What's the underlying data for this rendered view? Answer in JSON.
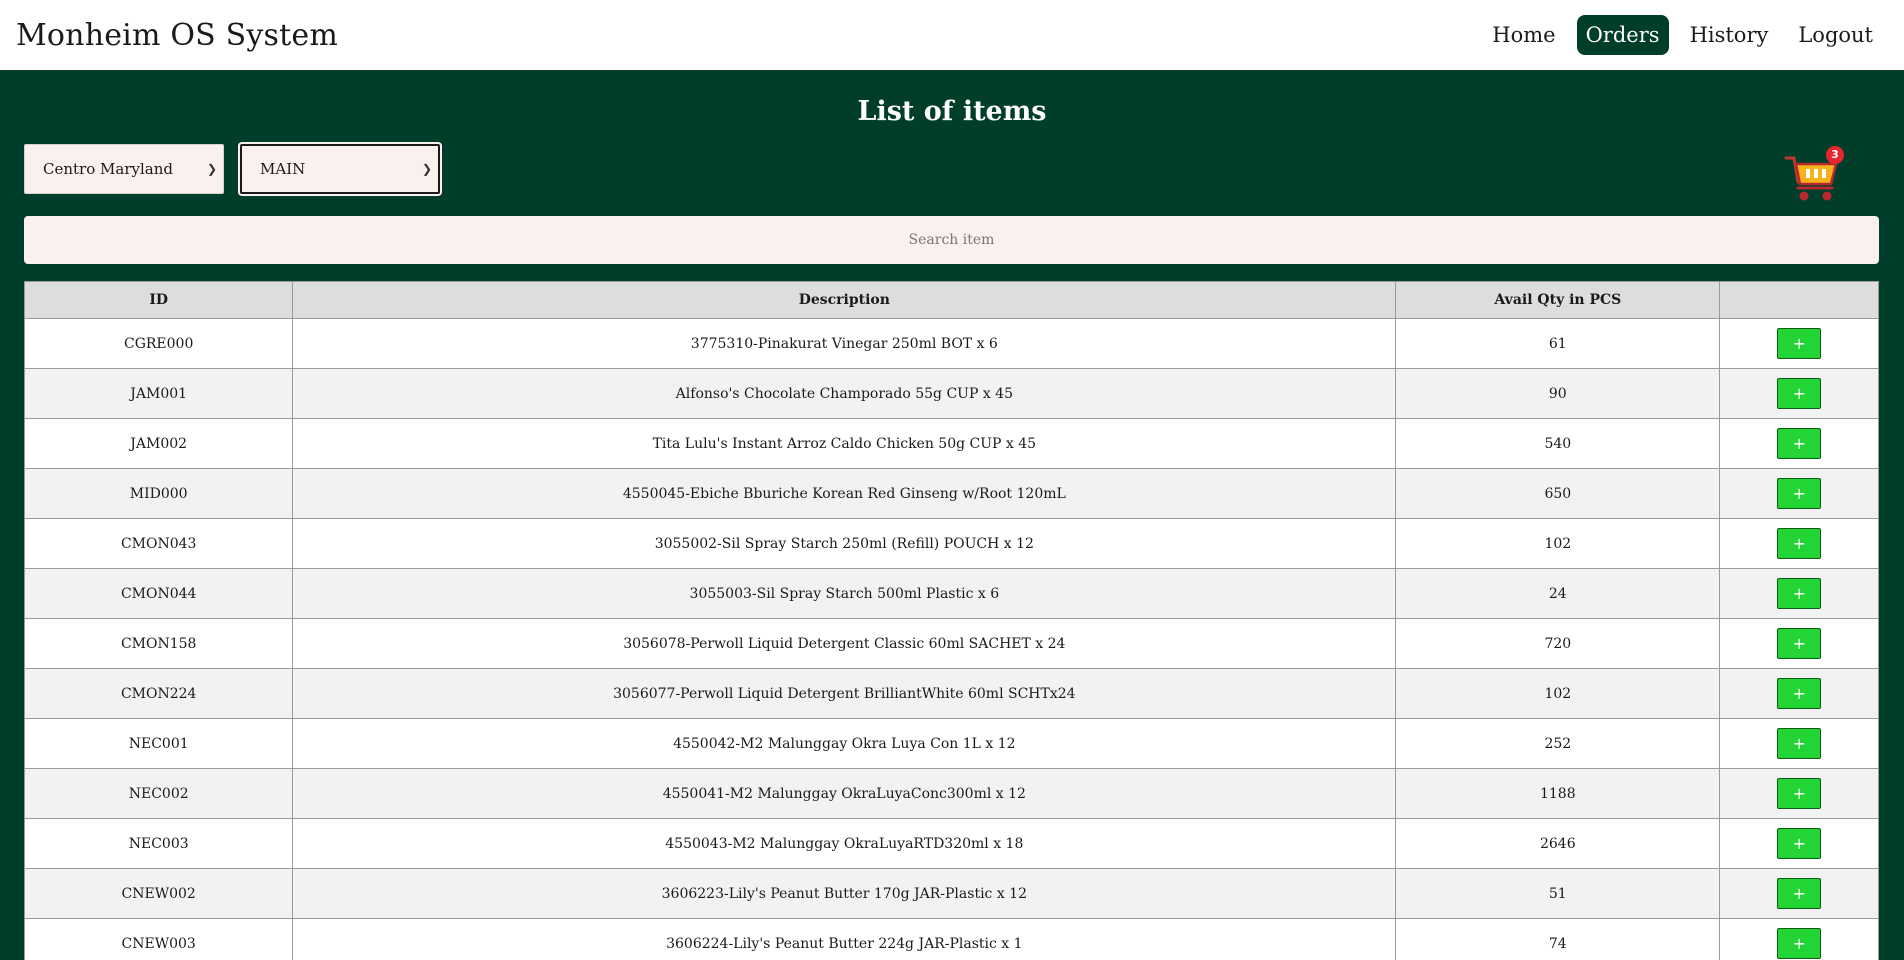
{
  "header": {
    "app_title": "Monheim OS System",
    "nav": [
      {
        "label": "Home",
        "active": false
      },
      {
        "label": "Orders",
        "active": true
      },
      {
        "label": "History",
        "active": false
      },
      {
        "label": "Logout",
        "active": false
      }
    ]
  },
  "main": {
    "title": "List of items",
    "location_select": {
      "value": "Centro Maryland"
    },
    "branch_select": {
      "value": "MAIN"
    },
    "cart": {
      "icon": "shopping-cart-icon",
      "count": "3"
    },
    "search": {
      "placeholder": "Search item",
      "value": ""
    },
    "table": {
      "headers": [
        "ID",
        "Description",
        "Avail Qty in PCS",
        ""
      ],
      "add_label": "+",
      "rows": [
        {
          "id": "CGRE000",
          "description": "3775310-Pinakurat Vinegar 250ml BOT x 6",
          "qty": "61"
        },
        {
          "id": "JAM001",
          "description": "Alfonso's Chocolate Champorado 55g CUP x 45",
          "qty": "90"
        },
        {
          "id": "JAM002",
          "description": "Tita Lulu's Instant Arroz Caldo Chicken 50g CUP x 45",
          "qty": "540"
        },
        {
          "id": "MID000",
          "description": "4550045-Ebiche Bburiche Korean Red Ginseng w/Root 120mL",
          "qty": "650"
        },
        {
          "id": "CMON043",
          "description": "3055002-Sil Spray Starch 250ml (Refill) POUCH x 12",
          "qty": "102"
        },
        {
          "id": "CMON044",
          "description": "3055003-Sil Spray Starch 500ml Plastic x 6",
          "qty": "24"
        },
        {
          "id": "CMON158",
          "description": "3056078-Perwoll Liquid Detergent Classic 60ml SACHET x 24",
          "qty": "720"
        },
        {
          "id": "CMON224",
          "description": "3056077-Perwoll Liquid Detergent BrilliantWhite 60ml SCHTx24",
          "qty": "102"
        },
        {
          "id": "NEC001",
          "description": "4550042-M2 Malunggay Okra Luya Con 1L x 12",
          "qty": "252"
        },
        {
          "id": "NEC002",
          "description": "4550041-M2 Malunggay OkraLuyaConc300ml x 12",
          "qty": "1188"
        },
        {
          "id": "NEC003",
          "description": "4550043-M2 Malunggay OkraLuyaRTD320ml x 18",
          "qty": "2646"
        },
        {
          "id": "CNEW002",
          "description": "3606223-Lily's Peanut Butter 170g JAR-Plastic x 12",
          "qty": "51"
        },
        {
          "id": "CNEW003",
          "description": "3606224-Lily's Peanut Butter 224g JAR-Plastic x 1",
          "qty": "74"
        }
      ]
    }
  },
  "colors": {
    "brand_green": "#003d2b",
    "add_button_green": "#22d534",
    "badge_red": "#e8262d"
  }
}
